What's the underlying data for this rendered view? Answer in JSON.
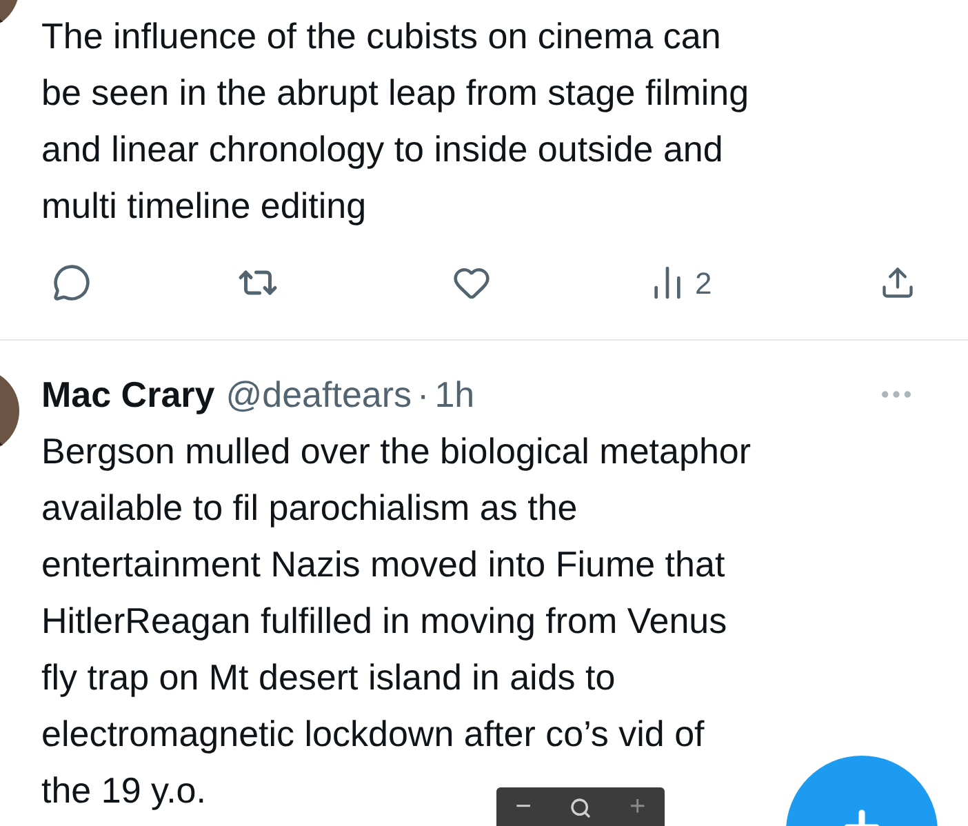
{
  "tweets": [
    {
      "text_lines": [
        "The influence of the cubists on cinema can",
        "be seen in the abrupt leap from stage filming",
        "and linear chronology to inside outside and",
        "multi timeline editing"
      ],
      "actions": {
        "views": "2"
      }
    },
    {
      "author": {
        "name": "Mac Crary",
        "handle": "@deaftears",
        "separator": "·",
        "time": "1h"
      },
      "text_lines": [
        "Bergson mulled over the biological metaphor",
        "available to fil parochialism as the",
        "entertainment Nazis moved into Fiume that",
        "HitlerReagan fulfilled in moving from Venus",
        "fly trap on Mt desert island in aids to",
        "electromagnetic lockdown after co’s vid of",
        "the 19 y.o."
      ]
    }
  ],
  "zoom_toolbar": {
    "minus": "−",
    "plus": "+"
  }
}
